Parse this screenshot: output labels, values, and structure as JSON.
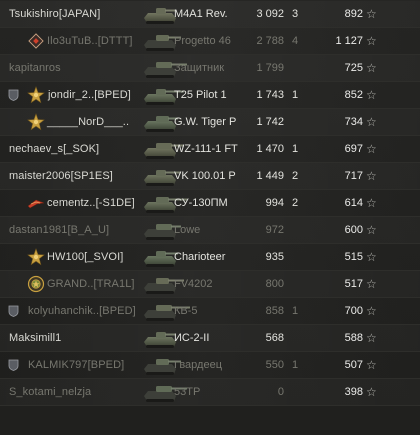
{
  "colors": {
    "background": "#1c1c1a",
    "row_text": "#d9d9d3",
    "dead_text": "#77776f",
    "accent_gold": "#c8a040",
    "rank_red": "#c8402a"
  },
  "players": [
    {
      "name": "Tsukishiro[JAPAN]",
      "vehicle": "M4A1 Rev.",
      "damage": "3 092",
      "frags": "3",
      "xp": "892",
      "badge": "",
      "rank": "",
      "dead": false
    },
    {
      "name": "Ilo3uTuB..[DTTT]",
      "vehicle": "Progetto 46",
      "damage": "2 788",
      "frags": "4",
      "xp": "1 127",
      "badge": "",
      "rank": "diamond-emblem-icon",
      "dead": true
    },
    {
      "name": "kapitanros",
      "vehicle": "Защитник",
      "damage": "1 799",
      "frags": "",
      "xp": "725",
      "badge": "",
      "rank": "",
      "dead": true
    },
    {
      "name": "jondir_2..[BPED]",
      "vehicle": "T25 Pilot 1",
      "damage": "1 743",
      "frags": "1",
      "xp": "852",
      "badge": "shield-icon",
      "rank": "gold-star-icon",
      "dead": false
    },
    {
      "name": "_____NorD___..",
      "vehicle": "G.W. Tiger P",
      "damage": "1 742",
      "frags": "",
      "xp": "734",
      "badge": "",
      "rank": "gold-star-icon",
      "dead": false
    },
    {
      "name": "nechaev_s[_SOK]",
      "vehicle": "WZ-111-1 FT",
      "damage": "1 470",
      "frags": "1",
      "xp": "697",
      "badge": "",
      "rank": "",
      "dead": false
    },
    {
      "name": "maister2006[SP1ES]",
      "vehicle": "VK 100.01 P",
      "damage": "1 449",
      "frags": "2",
      "xp": "717",
      "badge": "",
      "rank": "",
      "dead": false
    },
    {
      "name": "cementz..[-S1DE]",
      "vehicle": "СУ-130ПМ",
      "damage": "994",
      "frags": "2",
      "xp": "614",
      "badge": "",
      "rank": "red-chevron-icon",
      "dead": false
    },
    {
      "name": "dastan1981[B_A_U]",
      "vehicle": "Lowe",
      "damage": "972",
      "frags": "",
      "xp": "600",
      "badge": "",
      "rank": "",
      "dead": true
    },
    {
      "name": "HW100[_SVOI]",
      "vehicle": "Charioteer",
      "damage": "935",
      "frags": "",
      "xp": "515",
      "badge": "",
      "rank": "gold-star-icon",
      "dead": false
    },
    {
      "name": "GRAND..[TRA1L]",
      "vehicle": "FV4202",
      "damage": "800",
      "frags": "",
      "xp": "517",
      "badge": "",
      "rank": "gold-wreath-icon",
      "dead": true
    },
    {
      "name": "kolyuhanchik..[BPED]",
      "vehicle": "КВ-5",
      "damage": "858",
      "frags": "1",
      "xp": "700",
      "badge": "shield-icon",
      "rank": "",
      "dead": true
    },
    {
      "name": "Maksimill1",
      "vehicle": "ИС-2-II",
      "damage": "568",
      "frags": "",
      "xp": "588",
      "badge": "",
      "rank": "",
      "dead": false
    },
    {
      "name": "KALMIK797[BPED]",
      "vehicle": "Гвардеец",
      "damage": "550",
      "frags": "1",
      "xp": "507",
      "badge": "shield-icon",
      "rank": "",
      "dead": true
    },
    {
      "name": "S_kotami_nelzja",
      "vehicle": "53TP",
      "damage": "0",
      "frags": "",
      "xp": "398",
      "badge": "",
      "rank": "",
      "dead": true
    }
  ],
  "xp_icon": "star-icon"
}
